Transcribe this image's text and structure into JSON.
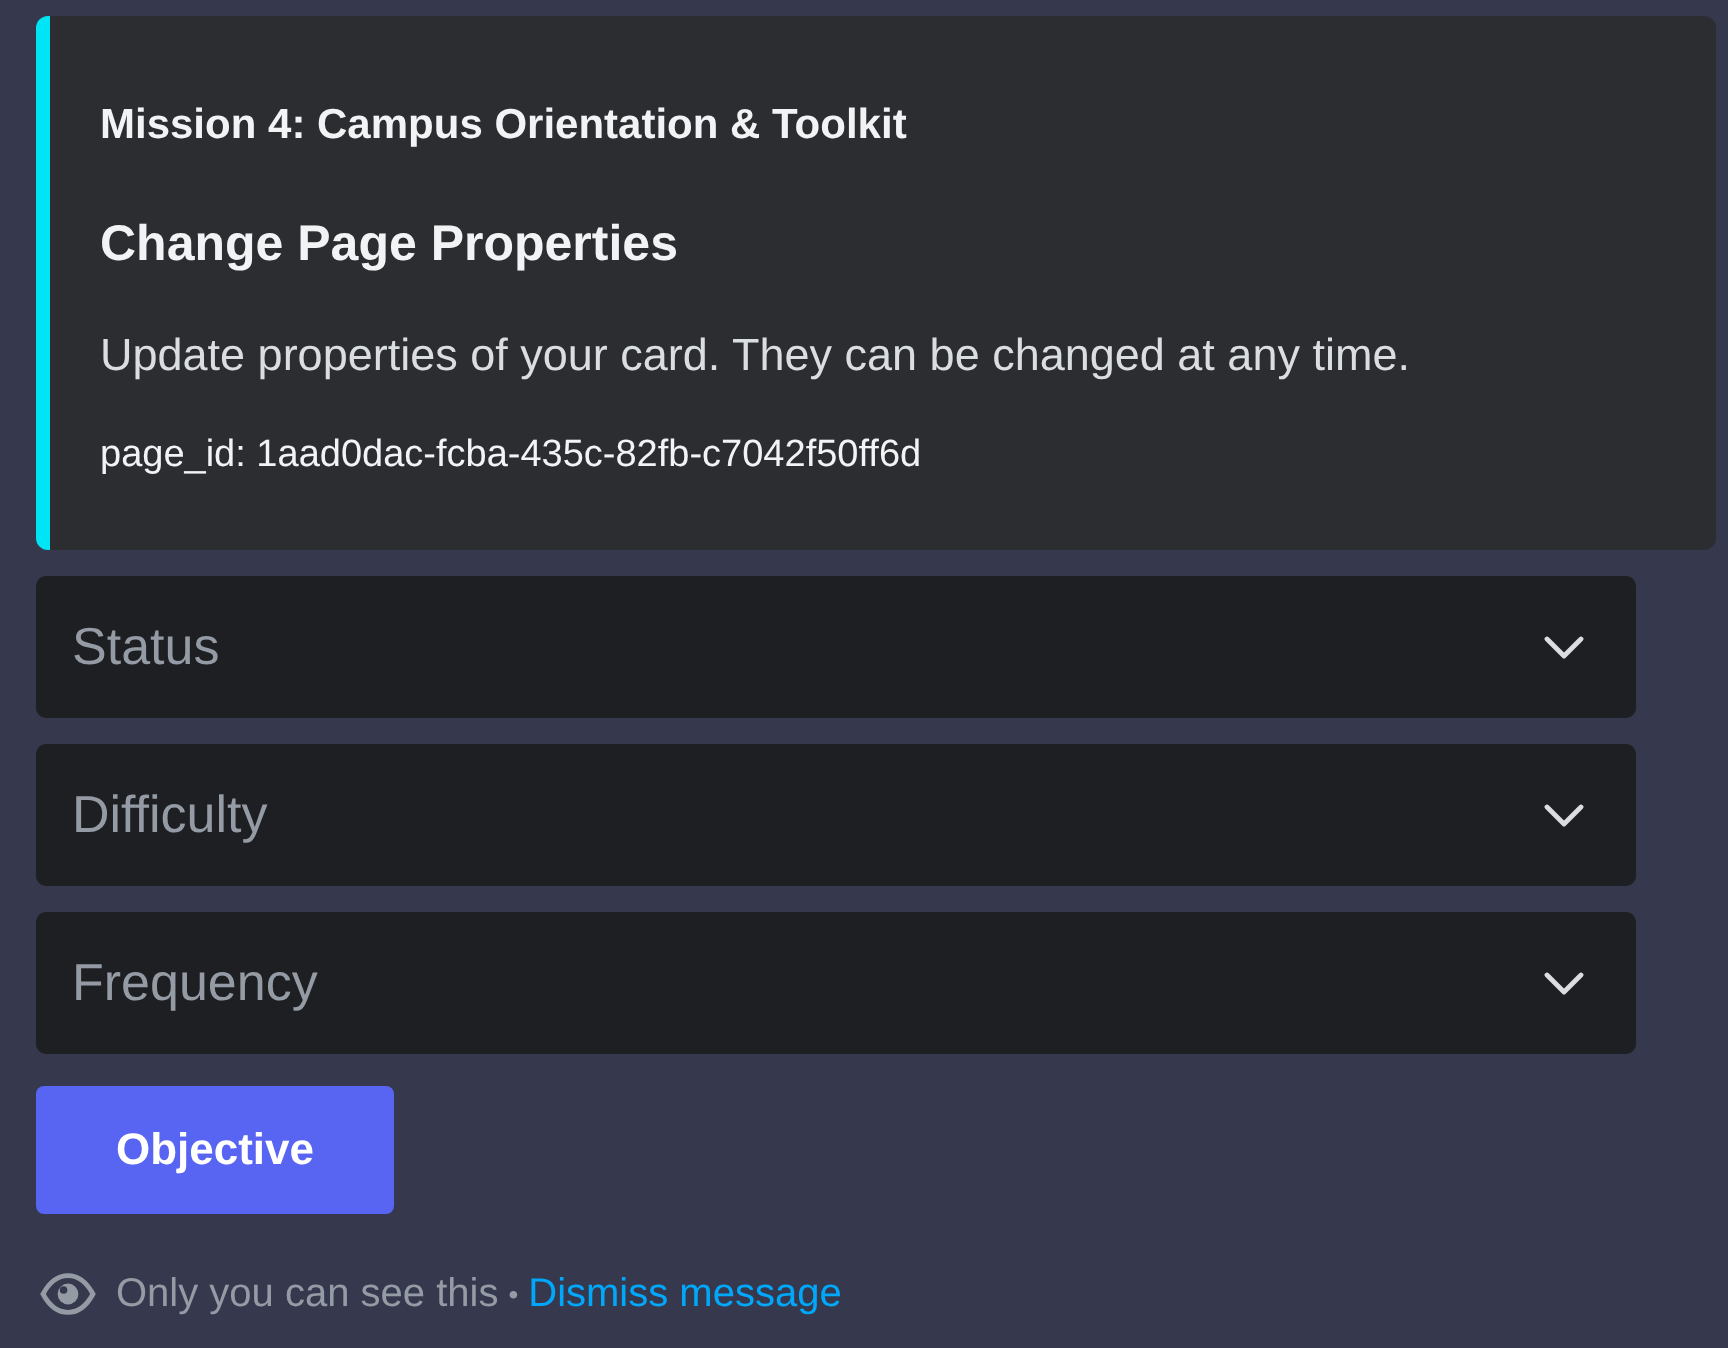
{
  "embed": {
    "author": "Mission 4: Campus Orientation & Toolkit",
    "title": "Change Page Properties",
    "description": "Update properties of your card. They can be changed at any time.",
    "page_id_line": "page_id: 1aad0dac-fcba-435c-82fb-c7042f50ff6d"
  },
  "selects": [
    {
      "placeholder": "Status"
    },
    {
      "placeholder": "Difficulty"
    },
    {
      "placeholder": "Frequency"
    }
  ],
  "buttons": [
    {
      "label": "Objective"
    }
  ],
  "notice": {
    "text": "Only you can see this",
    "separator": "•",
    "link": "Dismiss message"
  }
}
